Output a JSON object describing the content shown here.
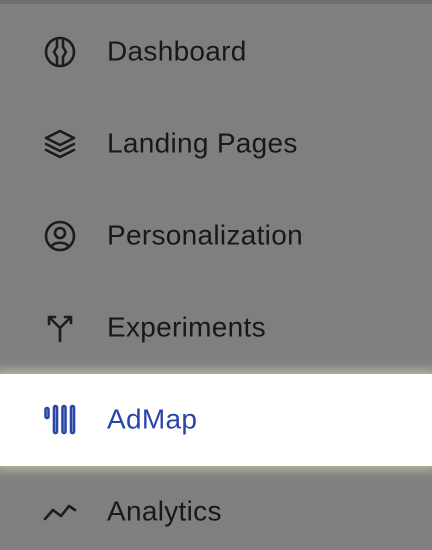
{
  "accent_color": "#2a45a8",
  "nav": {
    "items": [
      {
        "label": "Dashboard",
        "icon": "dashboard-icon",
        "active": false
      },
      {
        "label": "Landing Pages",
        "icon": "layers-icon",
        "active": false
      },
      {
        "label": "Personalization",
        "icon": "user-circle-icon",
        "active": false
      },
      {
        "label": "Experiments",
        "icon": "split-arrow-icon",
        "active": false
      },
      {
        "label": "AdMap",
        "icon": "admap-bars-icon",
        "active": true
      },
      {
        "label": "Analytics",
        "icon": "trend-line-icon",
        "active": false
      }
    ]
  }
}
